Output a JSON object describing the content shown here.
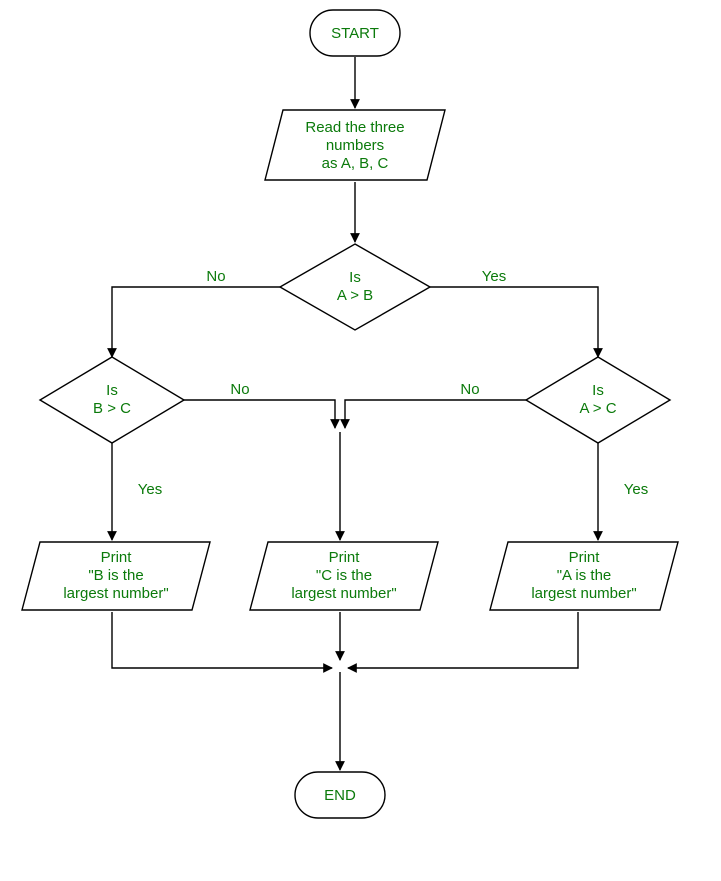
{
  "chart_data": {
    "type": "flowchart",
    "title": "",
    "nodes": [
      {
        "id": "start",
        "kind": "terminator",
        "label_lines": [
          "START"
        ]
      },
      {
        "id": "read",
        "kind": "io",
        "label_lines": [
          "Read the three",
          "numbers",
          "as A, B, C"
        ]
      },
      {
        "id": "ab",
        "kind": "decision",
        "label_lines": [
          "Is",
          "A > B"
        ]
      },
      {
        "id": "bc",
        "kind": "decision",
        "label_lines": [
          "Is",
          "B > C"
        ]
      },
      {
        "id": "ac",
        "kind": "decision",
        "label_lines": [
          "Is",
          "A > C"
        ]
      },
      {
        "id": "printB",
        "kind": "io",
        "label_lines": [
          "Print",
          "\"B is the",
          "largest number\""
        ]
      },
      {
        "id": "printC",
        "kind": "io",
        "label_lines": [
          "Print",
          "\"C is the",
          "largest number\""
        ]
      },
      {
        "id": "printA",
        "kind": "io",
        "label_lines": [
          "Print",
          "\"A is the",
          "largest number\""
        ]
      },
      {
        "id": "end",
        "kind": "terminator",
        "label_lines": [
          "END"
        ]
      }
    ],
    "edges": [
      {
        "id": "e_start_read",
        "from": "start",
        "to": "read",
        "label": ""
      },
      {
        "id": "e_read_ab",
        "from": "read",
        "to": "ab",
        "label": ""
      },
      {
        "id": "e_ab_bc_no",
        "from": "ab",
        "to": "bc",
        "label": "No"
      },
      {
        "id": "e_ab_ac_yes",
        "from": "ab",
        "to": "ac",
        "label": "Yes"
      },
      {
        "id": "e_bc_printB_yes",
        "from": "bc",
        "to": "printB",
        "label": "Yes"
      },
      {
        "id": "e_bc_printC_no",
        "from": "bc",
        "to": "printC",
        "label": "No"
      },
      {
        "id": "e_ac_printA_yes",
        "from": "ac",
        "to": "printA",
        "label": "Yes"
      },
      {
        "id": "e_ac_printC_no",
        "from": "ac",
        "to": "printC",
        "label": "No"
      },
      {
        "id": "e_printB_end",
        "from": "printB",
        "to": "end",
        "label": ""
      },
      {
        "id": "e_printC_end",
        "from": "printC",
        "to": "end",
        "label": ""
      },
      {
        "id": "e_printA_end",
        "from": "printA",
        "to": "end",
        "label": ""
      }
    ]
  }
}
